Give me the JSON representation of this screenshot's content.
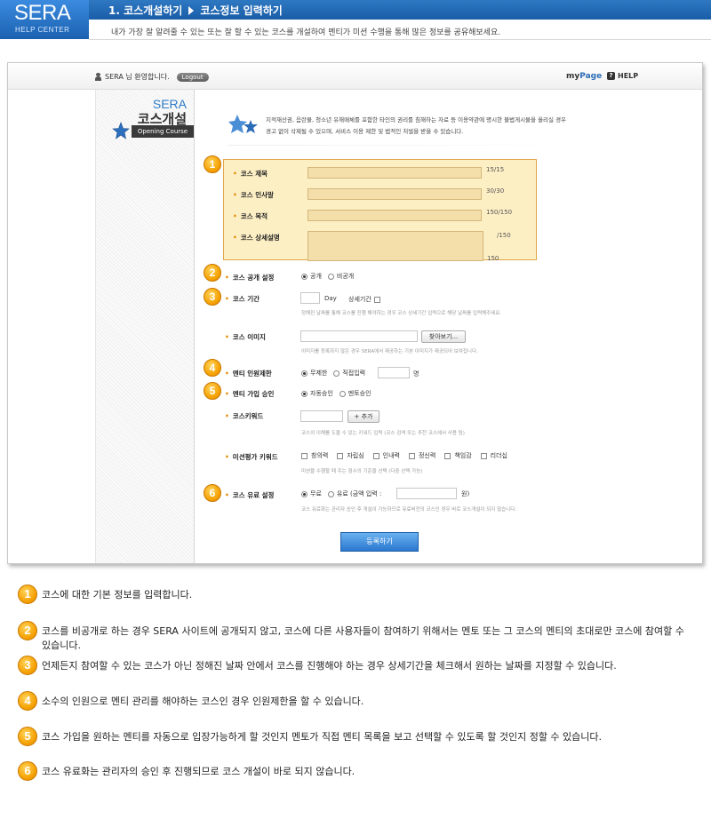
{
  "header": {
    "logo_main": "SERA",
    "logo_sub": "HELP CENTER",
    "crumb_step": "1. 코스개설하기",
    "crumb_current": "코스정보 입력하기",
    "description": "내가 가장 잘 알려줄 수 있는 또는 잘 할 수 있는 코스를 개설하여 멘티가 미션 수행을 통해 많은 정보를 공유해보세요."
  },
  "topbar": {
    "welcome": "SERA 님 환영합니다.",
    "logout": "Logout",
    "mypage_a": "my",
    "mypage_b": "Page",
    "help": "HELP"
  },
  "leftcol": {
    "sera": "SERA",
    "title": "코스개설",
    "tag": "Opening Course"
  },
  "notice": {
    "line1": "지적재산권, 음란물, 청소년 유해매체를 포함한 타인의 권리를 침해하는 자료 등 이용약관에 명시한 불법게시물을 올리실 경우",
    "line2": "경고 없이 삭제될 수 있으며, 서비스 이용 제한 및 법적인 처벌을 받을 수 있습니다."
  },
  "form": {
    "title_label": "코스 제목",
    "title_count": "15/15",
    "greeting_label": "코스 인사말",
    "greeting_count": "30/30",
    "goal_label": "코스 목적",
    "goal_count": "150/150",
    "detail_label": "코스 상세설명",
    "detail_count": "/150",
    "detail_count2": "150",
    "public_label": "코스 공개 설정",
    "public_opt1": "공개",
    "public_opt2": "비공개",
    "period_label": "코스 기간",
    "period_unit": "Day",
    "period_detail": "상세기간",
    "period_hint": "정해진 날짜를 통해 코스를 진행 해야하는 경우 코스 상세기간 입력으로 해당 날짜를 입력해주세요.",
    "image_label": "코스 이미지",
    "image_button": "찾아보기...",
    "image_hint": "이미지를 등록하지 않은 경우 SERA에서 제공하는 기본 이미지가 제공되어 보여집니다.",
    "limit_label": "멘티 인원제한",
    "limit_opt1": "무제한",
    "limit_opt2": "직접입력",
    "limit_unit": "명",
    "join_label": "멘티 가입 승인",
    "join_opt1": "자동승인",
    "join_opt2": "멘토승인",
    "keyword_label": "코스키워드",
    "keyword_button": "+ 추가",
    "keyword_hint": "코스의 이해를 도울 수 있는 키워드 입력 (코스 검색 또는 추천 코스에서 사용 됨)",
    "eval_label": "미션평가 키워드",
    "eval_opts": [
      "창의력",
      "자립심",
      "인내력",
      "정신력",
      "책임감",
      "리더십"
    ],
    "eval_hint": "미션을 수행할 때 주는 점수의 기준을 선택 (다중 선택 가능)",
    "paid_label": "코스 유료 설정",
    "paid_opt1": "무료",
    "paid_opt2": "유료 (금액 입력 :",
    "paid_unit": "원)",
    "paid_hint": "코스 유료화는 관리자 승인 후 개설이 가능하므로 유료버전의 코스인 경우 바로 코스개설이 되지 않습니다.",
    "submit": "등록하기"
  },
  "explanations": [
    {
      "num": "1",
      "text": "코스에 대한 기본 정보를 입력합니다."
    },
    {
      "num": "2",
      "text": "코스를 비공개로 하는 경우 SERA 사이트에 공개되지 않고, 코스에 다른 사용자들이 참여하기 위해서는 멘토 또는 그 코스의 멘티의 초대로만 코스에 참여할 수 있습니다."
    },
    {
      "num": "3",
      "text": "언제든지 참여할 수 있는 코스가 아닌 정해진 날짜 안에서 코스를 진행해야 하는 경우 상세기간을 체크해서 원하는 날짜를 지정할 수 있습니다."
    },
    {
      "num": "4",
      "text": "소수의 인원으로 멘티 관리를 해야하는 코스인 경우 인원제한을 할 수 있습니다."
    },
    {
      "num": "5",
      "text": "코스 가입을 원하는 멘티를 자동으로 입장가능하게 할 것인지 멘토가 직접 멘티 목록을 보고 선택할 수 있도록 할 것인지 정할 수 있습니다."
    },
    {
      "num": "6",
      "text": "코스 유료화는 관리자의 승인 후 진행되므로 코스 개설이 바로 되지 않습니다."
    }
  ],
  "markers": [
    "1",
    "2",
    "3",
    "4",
    "5",
    "6"
  ]
}
